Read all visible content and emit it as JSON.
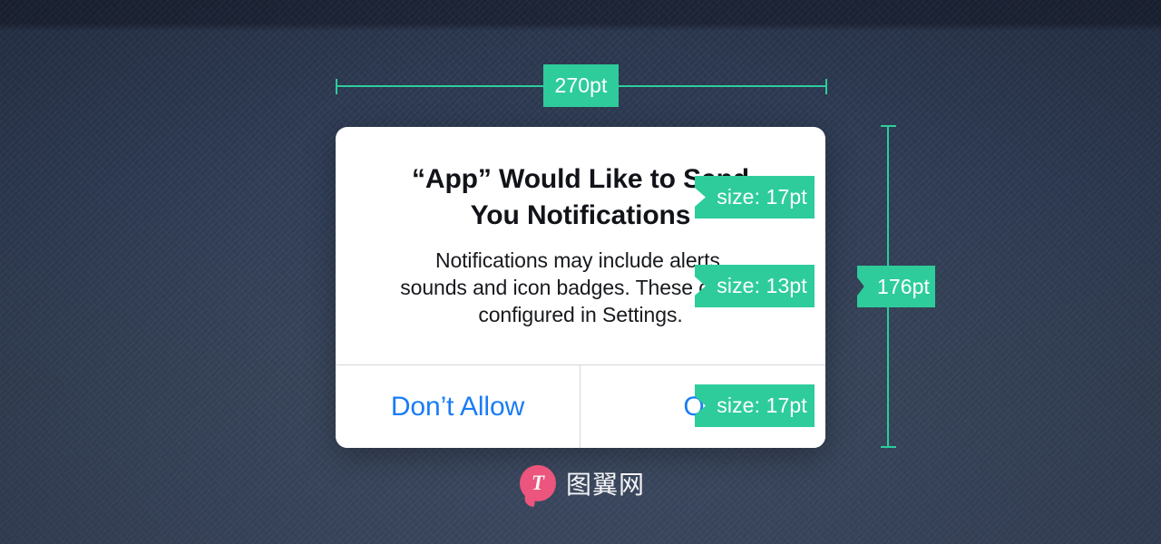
{
  "background": {
    "base_color": "#303d56",
    "top_band_color": "#1d2436",
    "bottom_color": "#3e4b63"
  },
  "accent": {
    "measure_color": "#2ecc9b",
    "ios_blue": "#1a7cf5",
    "watermark_pink": "#f6567f"
  },
  "dialog": {
    "title": "“App” Would Like to Send You Notifications",
    "title_line_1": "“App” Would Like to Send",
    "title_line_2": "You Notifications",
    "message": "Notifications may include alerts, sounds and icon badges. These can be configured in Settings.",
    "message_line_1": "Notifications may include alerts,",
    "message_line_2": "sounds and icon badges. These can be",
    "message_line_3": "configured in Settings.",
    "buttons": {
      "deny_label": "Don’t Allow",
      "allow_label": "OK"
    }
  },
  "measurements": {
    "width_badge": "270pt",
    "height_badge": "176pt",
    "title_size_badge": "size: 17pt",
    "message_size_badge": "size: 13pt",
    "button_size_badge": "size: 17pt"
  },
  "watermark": {
    "logo_letter": "T",
    "text": "图翼网"
  }
}
